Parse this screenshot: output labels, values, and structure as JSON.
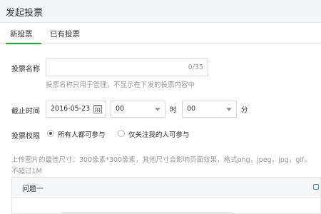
{
  "header": {
    "title": "发起投票"
  },
  "tabs": [
    {
      "label": "新投票"
    },
    {
      "label": "已有投票"
    }
  ],
  "form": {
    "name": {
      "label": "投票名称",
      "counter": "0/35",
      "hint": "投票名称只用于管理，不显示在下发的投票内容中"
    },
    "deadline": {
      "label": "截止时间",
      "date": "2016-05-23",
      "hour": "00",
      "hour_unit": "时",
      "minute": "00",
      "minute_unit": "分"
    },
    "permission": {
      "label": "投票权限",
      "option_all": "所有人都可参与",
      "option_followers": "仅关注我的人可参与",
      "selected": "all"
    },
    "upload_note_line1": "上传图片的最佳尺寸：300像素*300像素，其他尺寸会影响页面效果，格式png，jpeg，jpg，gif。",
    "upload_note_line2": "不超过1M"
  },
  "question": {
    "title": "问题一"
  },
  "colors": {
    "accent": "#1aad19",
    "hint": "#999999",
    "border": "#d9d9d9"
  }
}
